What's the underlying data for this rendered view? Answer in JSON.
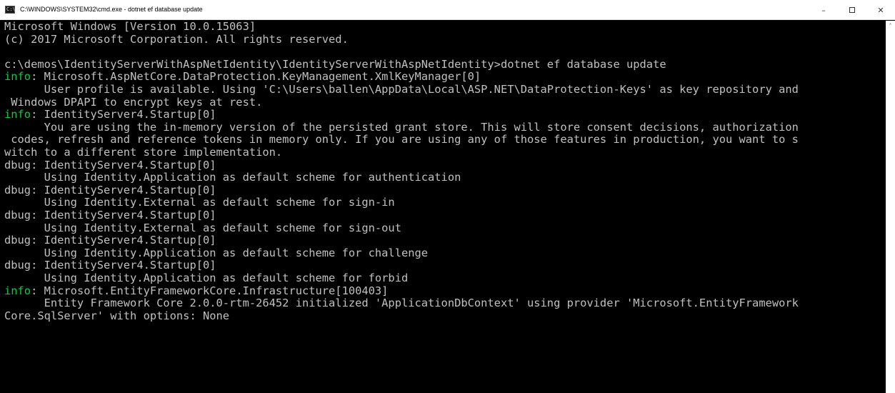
{
  "window": {
    "title": "C:\\WINDOWS\\SYSTEM32\\cmd.exe - dotnet  ef database update",
    "icon": "cmd-console-icon",
    "controls": {
      "minimize": "–",
      "maximize": "maximize-icon",
      "close": "✕"
    }
  },
  "colors": {
    "background": "#000000",
    "text": "#c0c0c0",
    "info": "#13c93a"
  },
  "scrollbar": {
    "up_arrow": "˄"
  },
  "console": {
    "lines": [
      {
        "text": "Microsoft Windows [Version 10.0.15063]"
      },
      {
        "text": "(c) 2017 Microsoft Corporation. All rights reserved."
      },
      {
        "text": ""
      },
      {
        "text": "c:\\demos\\IdentityServerWithAspNetIdentity\\IdentityServerWithAspNetIdentity>dotnet ef database update"
      },
      {
        "level": "info",
        "text": ": Microsoft.AspNetCore.DataProtection.KeyManagement.XmlKeyManager[0]"
      },
      {
        "text": "      User profile is available. Using 'C:\\Users\\ballen\\AppData\\Local\\ASP.NET\\DataProtection-Keys' as key repository and"
      },
      {
        "text": " Windows DPAPI to encrypt keys at rest."
      },
      {
        "level": "info",
        "text": ": IdentityServer4.Startup[0]"
      },
      {
        "text": "      You are using the in-memory version of the persisted grant store. This will store consent decisions, authorization"
      },
      {
        "text": " codes, refresh and reference tokens in memory only. If you are using any of those features in production, you want to s"
      },
      {
        "text": "witch to a different store implementation."
      },
      {
        "level": "dbug",
        "text": ": IdentityServer4.Startup[0]"
      },
      {
        "text": "      Using Identity.Application as default scheme for authentication"
      },
      {
        "level": "dbug",
        "text": ": IdentityServer4.Startup[0]"
      },
      {
        "text": "      Using Identity.External as default scheme for sign-in"
      },
      {
        "level": "dbug",
        "text": ": IdentityServer4.Startup[0]"
      },
      {
        "text": "      Using Identity.External as default scheme for sign-out"
      },
      {
        "level": "dbug",
        "text": ": IdentityServer4.Startup[0]"
      },
      {
        "text": "      Using Identity.Application as default scheme for challenge"
      },
      {
        "level": "dbug",
        "text": ": IdentityServer4.Startup[0]"
      },
      {
        "text": "      Using Identity.Application as default scheme for forbid"
      },
      {
        "level": "info",
        "text": ": Microsoft.EntityFrameworkCore.Infrastructure[100403]"
      },
      {
        "text": "      Entity Framework Core 2.0.0-rtm-26452 initialized 'ApplicationDbContext' using provider 'Microsoft.EntityFramework"
      },
      {
        "text": "Core.SqlServer' with options: None"
      }
    ]
  }
}
